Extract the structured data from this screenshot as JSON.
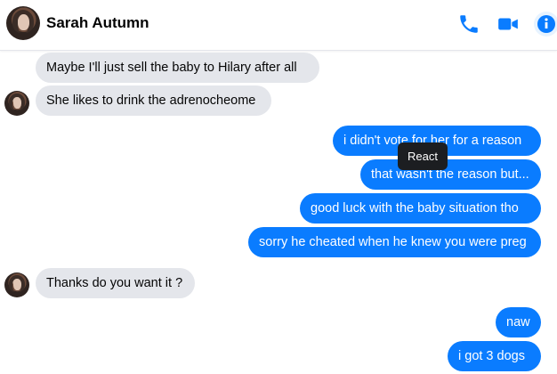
{
  "header": {
    "contact_name": "Sarah Autumn",
    "icons": [
      "phone-icon",
      "video-camera-icon",
      "info-icon"
    ],
    "accent_color": "#0a7cff"
  },
  "messages": [
    {
      "side": "incoming",
      "text": "Maybe I'll just sell the baby to Hilary after all"
    },
    {
      "side": "incoming",
      "text": "She likes to drink the adrenocheome"
    },
    {
      "side": "outgoing",
      "text": "i didn't vote for her for a reason"
    },
    {
      "side": "outgoing",
      "text": "that wasn't the reason but..."
    },
    {
      "side": "outgoing",
      "text": "good luck with the baby situation tho"
    },
    {
      "side": "outgoing",
      "text": "sorry he cheated when he knew you were preg"
    },
    {
      "side": "incoming",
      "text": "Thanks do you want it ?"
    },
    {
      "side": "outgoing",
      "text": "naw"
    },
    {
      "side": "outgoing",
      "text": "i got 3 dogs"
    }
  ],
  "tooltip": {
    "text": "React"
  }
}
